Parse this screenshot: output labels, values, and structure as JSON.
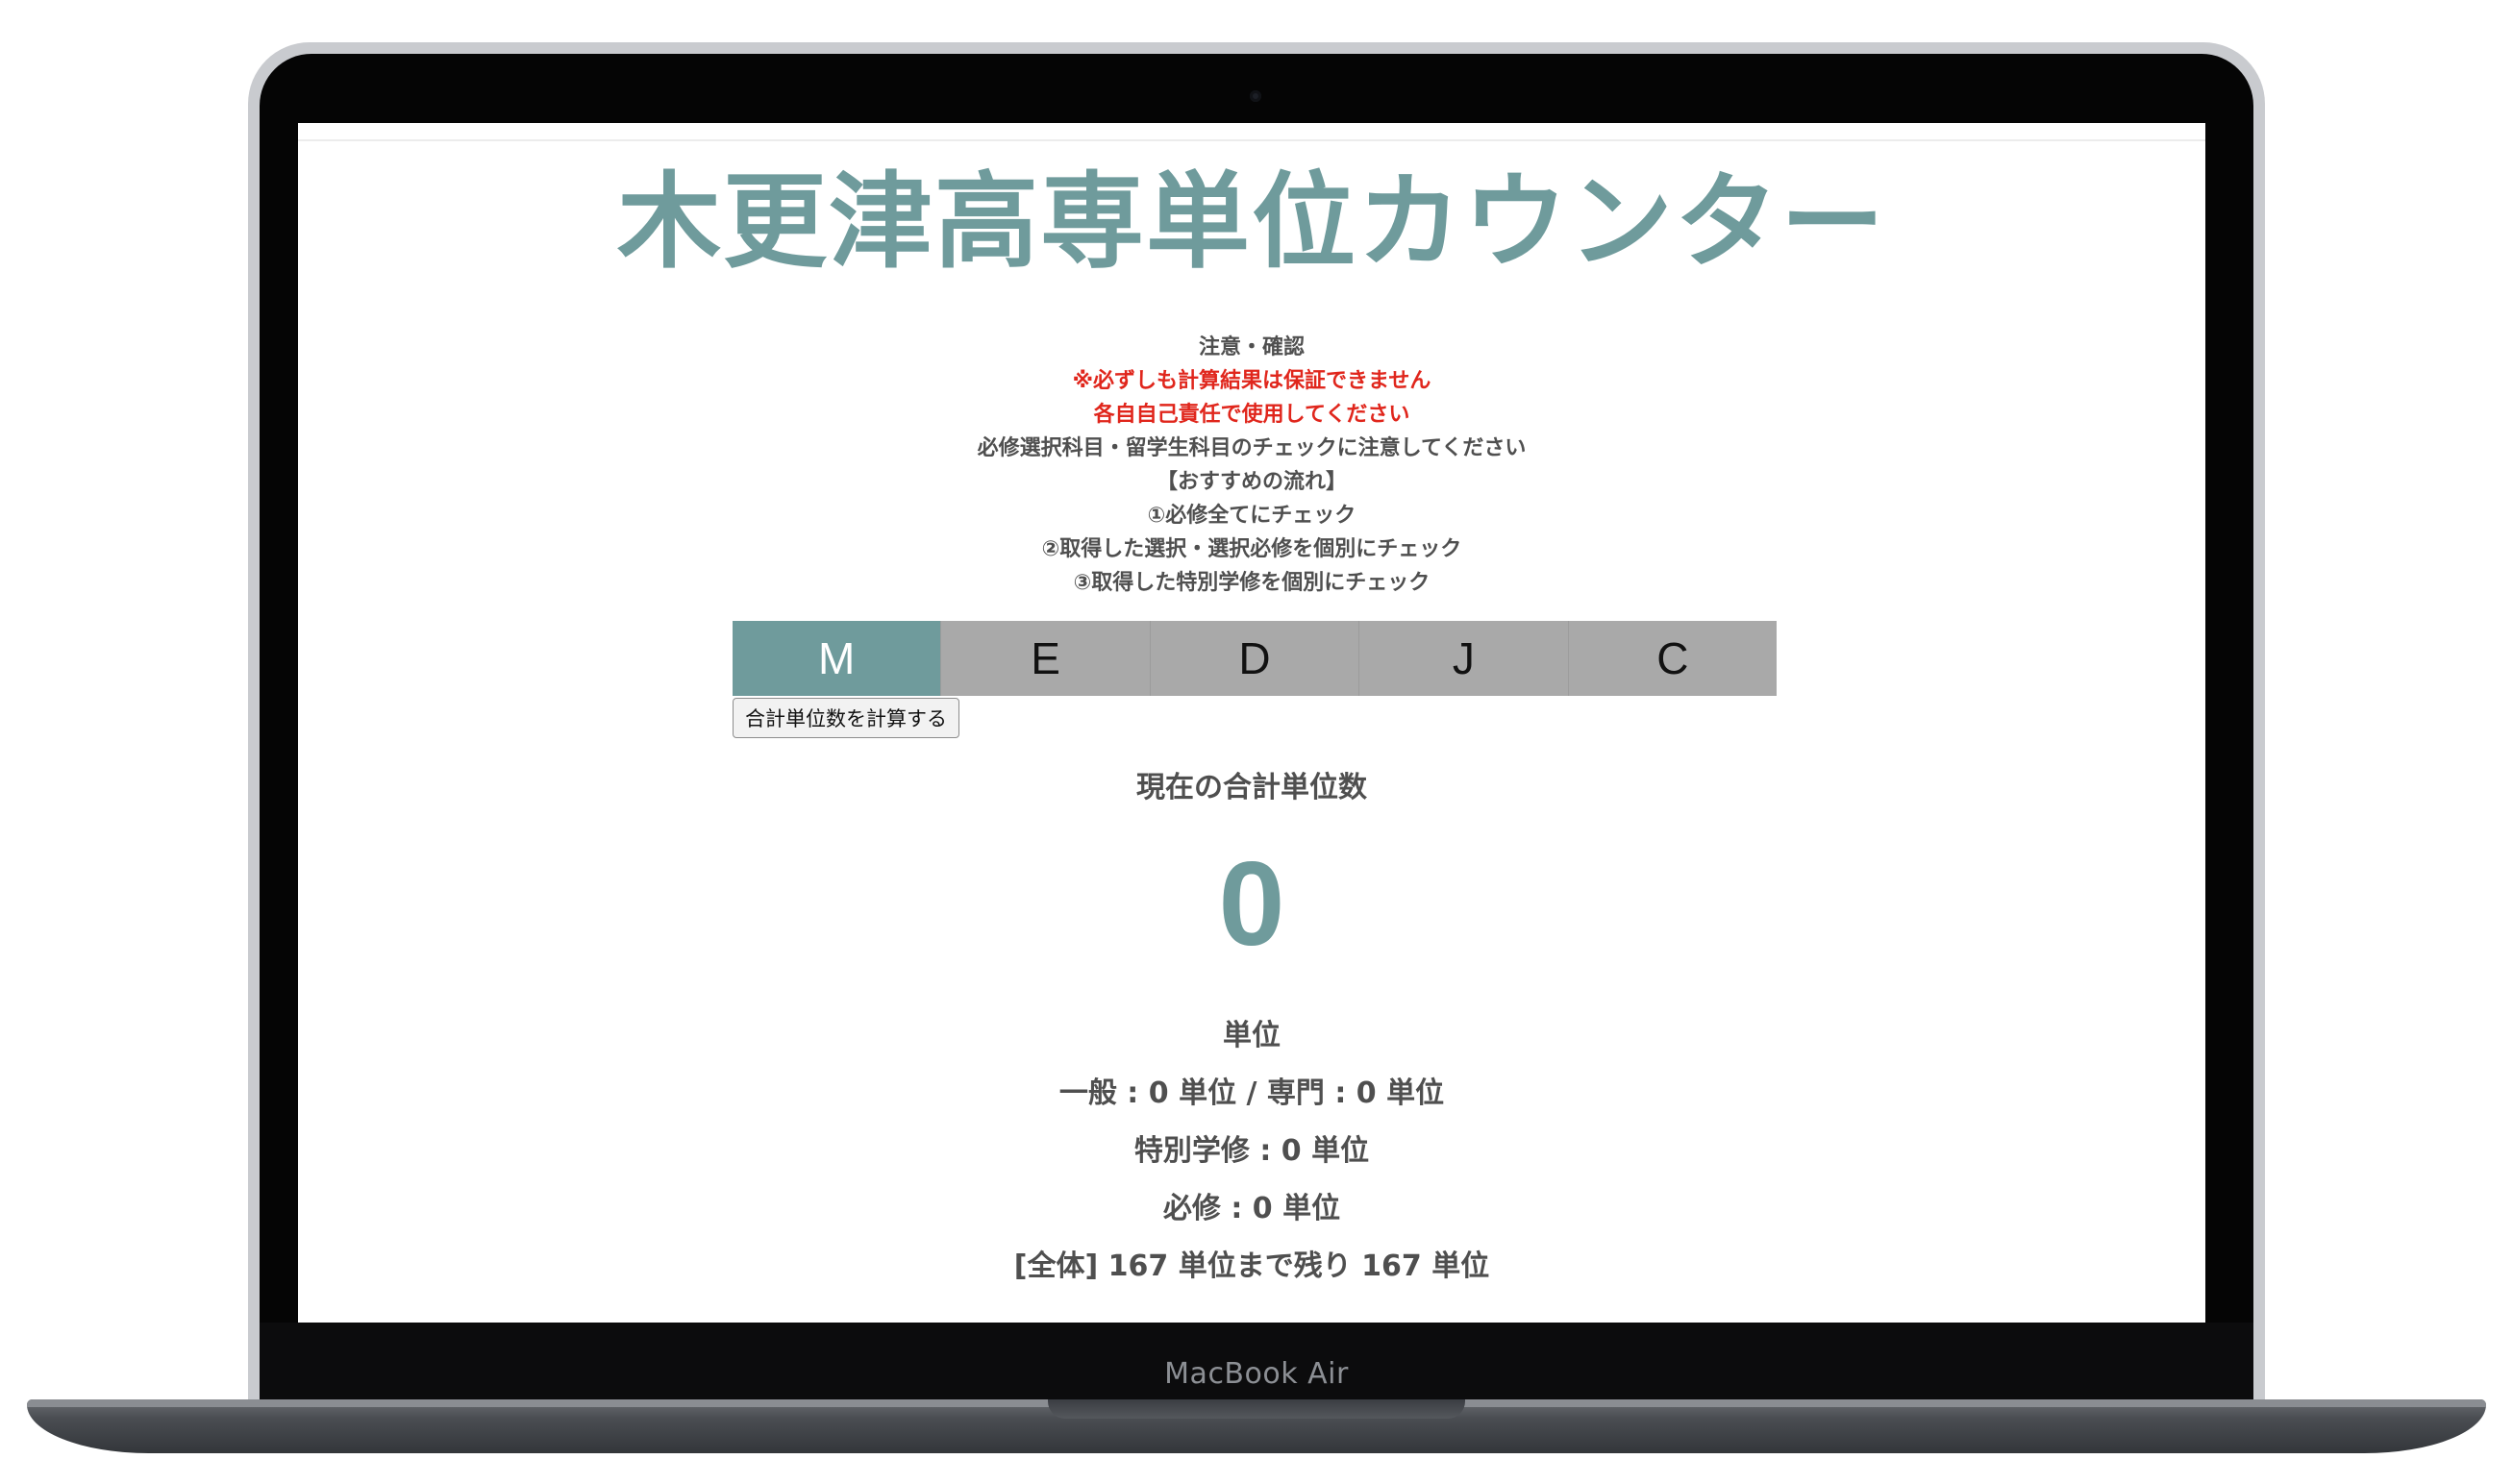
{
  "device": {
    "brand": "MacBook Air"
  },
  "page": {
    "title": "木更津高専単位カウンター",
    "notes": {
      "heading": "注意・確認",
      "warning1": "※必ずしも計算結果は保証できません",
      "warning2": "各自自己責任で使用してください",
      "caution": "必修選択科目・留学生科目のチェックに注意してください",
      "flow_heading": "【おすすめの流れ】",
      "step1": "①必修全てにチェック",
      "step2": "②取得した選択・選択必修を個別にチェック",
      "step3": "③取得した特別学修を個別にチェック"
    },
    "tabs": [
      {
        "label": "M",
        "active": true
      },
      {
        "label": "E",
        "active": false
      },
      {
        "label": "D",
        "active": false
      },
      {
        "label": "J",
        "active": false
      },
      {
        "label": "C",
        "active": false
      }
    ],
    "calculate_button": "合計単位数を計算する",
    "current_total_label": "現在の合計単位数",
    "current_total_value": "0",
    "unit_label": "単位",
    "breakdown": {
      "general_specialized": "一般 : 0 単位 / 専門 : 0 単位",
      "special_study": "特別学修 : 0 単位",
      "required": "必修 : 0 単位",
      "overall_remaining": "[全体] 167 単位まで残り 167 単位"
    }
  },
  "colors": {
    "accent": "#6f9b9c",
    "warning": "#e0261c",
    "text": "#4f4f4f",
    "tab_inactive": "#a9a9a9"
  }
}
